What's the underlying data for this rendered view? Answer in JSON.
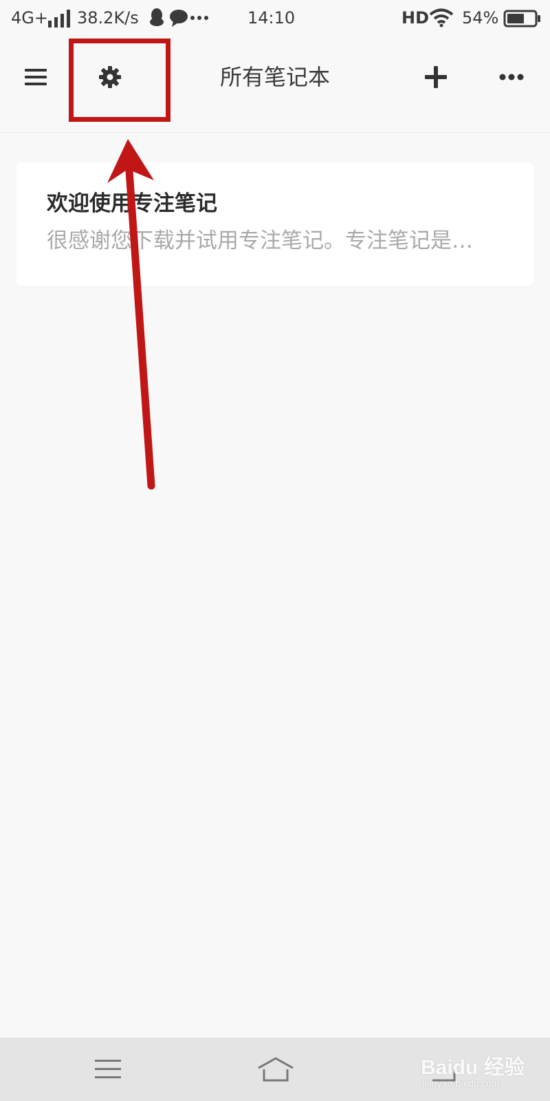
{
  "status_bar": {
    "network": "4G+",
    "speed": "38.2K/s",
    "time": "14:10",
    "hd": "HD",
    "battery": "54%"
  },
  "app_bar": {
    "title": "所有笔记本",
    "menu_icon": "menu-icon",
    "settings_icon": "gear-icon",
    "add_icon": "plus-icon",
    "more_icon": "more-icon"
  },
  "notes": [
    {
      "title": "欢迎使用专注笔记",
      "preview": "很感谢您下载并试用专注笔记。专注笔记是…"
    }
  ],
  "annotation": {
    "color": "#c01616"
  },
  "watermark": {
    "brand": "Baidu 经验",
    "sub": "jingyan.baidu.com"
  }
}
